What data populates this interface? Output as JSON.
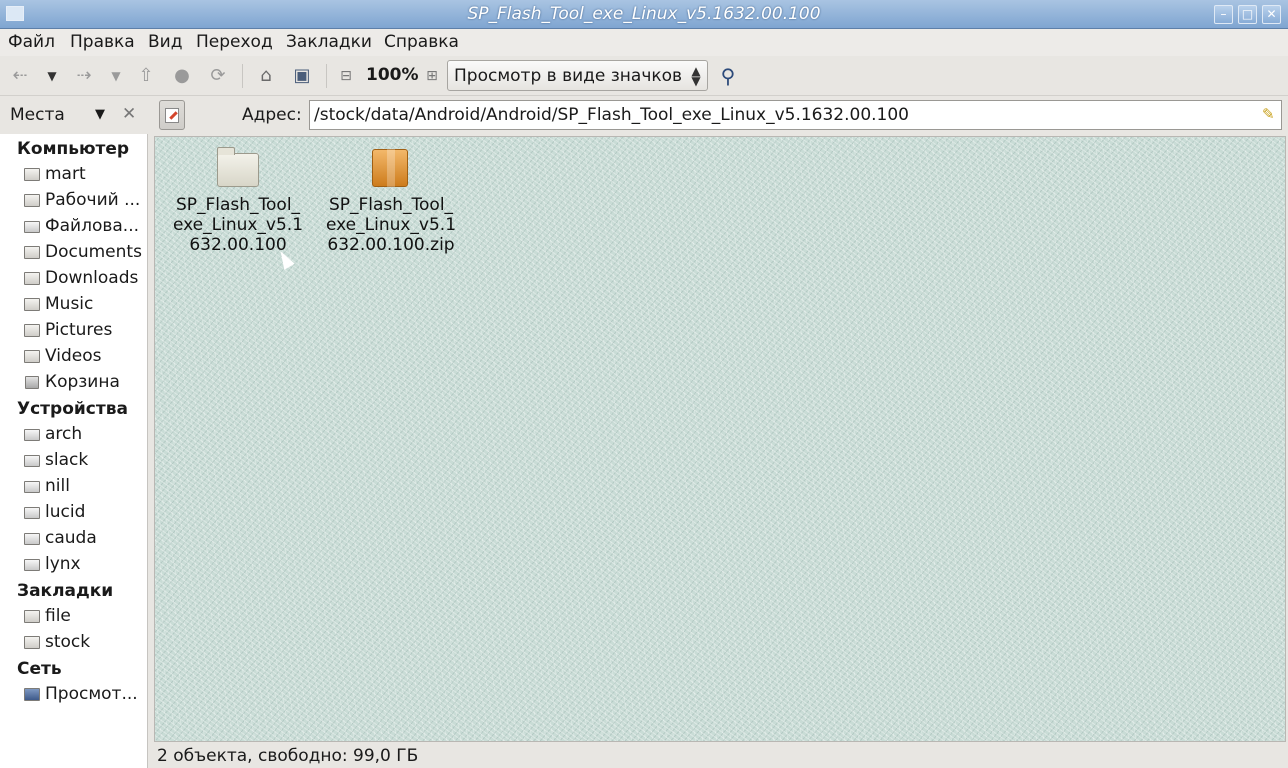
{
  "window": {
    "title": "SP_Flash_Tool_exe_Linux_v5.1632.00.100",
    "minimize": "–",
    "maximize": "□",
    "close": "✕"
  },
  "menu": [
    "Файл",
    "Правка",
    "Вид",
    "Переход",
    "Закладки",
    "Справка"
  ],
  "toolbar": {
    "icons": [
      "back-icon",
      "forward-icon",
      "up-icon",
      "stop-icon",
      "reload-icon",
      "home-icon",
      "computer-icon",
      "zoom-out-icon",
      "zoom-in-icon",
      "search-icon"
    ],
    "zoom": "100%",
    "view_mode": "Просмотр в виде значков"
  },
  "sidebar_header": {
    "label": "Места"
  },
  "address": {
    "label": "Адрес:",
    "value": "/stock/data/Android/Android/SP_Flash_Tool_exe_Linux_v5.1632.00.100"
  },
  "sidebar": {
    "computer": {
      "title": "Компьютер",
      "items": [
        "mart",
        "Рабочий ...",
        "Файлова...",
        "Documents",
        "Downloads",
        "Music",
        "Pictures",
        "Videos",
        "Корзина"
      ]
    },
    "devices": {
      "title": "Устройства",
      "items": [
        "arch",
        "slack",
        "nill",
        "lucid",
        "cauda",
        "lynx"
      ]
    },
    "bookmarks": {
      "title": "Закладки",
      "items": [
        "file",
        "stock"
      ]
    },
    "network": {
      "title": "Сеть",
      "items": [
        "Просмот..."
      ]
    }
  },
  "files": [
    {
      "name": "SP_Flash_Tool_exe_Linux_v5.1632.00.100",
      "type": "folder"
    },
    {
      "name": "SP_Flash_Tool_exe_Linux_v5.1632.00.100.zip",
      "type": "zip"
    }
  ],
  "status": "2 объекта, свободно: 99,0 ГБ",
  "colors": {
    "titlebar": "#8fb1d9",
    "content_bg": "#c9dcd6"
  }
}
